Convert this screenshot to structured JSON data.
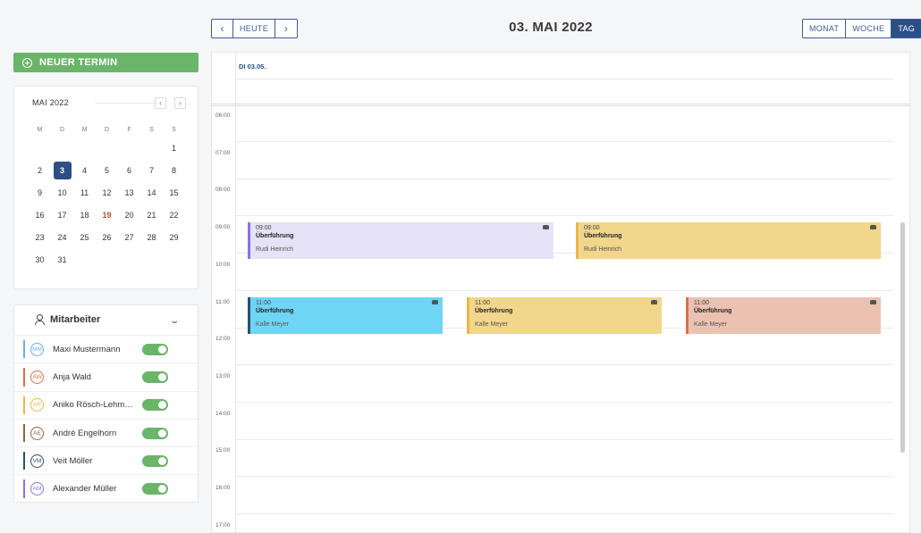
{
  "toolbar": {
    "prev_icon": "chevron-left-icon",
    "today_label": "HEUTE",
    "next_icon": "chevron-right-icon",
    "title": "03. MAI 2022",
    "views": [
      "MONAT",
      "WOCHE",
      "TAG"
    ],
    "active_view": "TAG"
  },
  "sidebar": {
    "new_button_label": "NEUER TERMIN",
    "mini_calendar": {
      "month_label": "MAI 2022",
      "weekdays": [
        "M",
        "D",
        "M",
        "D",
        "F",
        "S",
        "S"
      ],
      "days": [
        "",
        "",
        "",
        "",
        "",
        "",
        "1",
        "2",
        "3",
        "4",
        "5",
        "6",
        "7",
        "8",
        "9",
        "10",
        "11",
        "12",
        "13",
        "14",
        "15",
        "16",
        "17",
        "18",
        "19",
        "20",
        "21",
        "22",
        "23",
        "24",
        "25",
        "26",
        "27",
        "28",
        "29",
        "30",
        "31",
        "",
        "",
        "",
        "",
        ""
      ],
      "selected_day": "3",
      "highlighted_day": "19"
    },
    "staff": {
      "title": "Mitarbeiter",
      "members": [
        {
          "initials": "MM",
          "name": "Maxi Mustermann",
          "color": "#6aaee8",
          "enabled": true
        },
        {
          "initials": "AW",
          "name": "Anja Wald",
          "color": "#d9714a",
          "enabled": true
        },
        {
          "initials": "AR",
          "name": "Aniko Rösch-Lehm…",
          "color": "#e8b84a",
          "enabled": true
        },
        {
          "initials": "AE",
          "name": "André Engelhorn",
          "color": "#8a6a3c",
          "enabled": true
        },
        {
          "initials": "VM",
          "name": "Veit Möller",
          "color": "#2c4f6e",
          "enabled": true
        },
        {
          "initials": "AM",
          "name": "Alexander Müller",
          "color": "#8a72e0",
          "enabled": true
        }
      ]
    }
  },
  "calendar": {
    "day_header": "DI 03.05.",
    "times": [
      "06:00",
      "07:00",
      "08:00",
      "09:00",
      "10:00",
      "11:00",
      "12:00",
      "13:00",
      "14:00",
      "15:00",
      "16:00",
      "17:00"
    ],
    "events": [
      {
        "time": "09:00",
        "subject": "Überführung",
        "person": "Rudi Heinrich",
        "bg": "#e6e3f8",
        "border": "#8a72e0"
      },
      {
        "time": "09:00",
        "subject": "Überführung",
        "person": "Rudi Heinrich",
        "bg": "#f2d68c",
        "border": "#e8b84a"
      },
      {
        "time": "11:00",
        "subject": "Überführung",
        "person": "Kalle Meyer",
        "bg": "#6fd5f5",
        "border": "#2c4f6e"
      },
      {
        "time": "11:00",
        "subject": "Überführung",
        "person": "Kalle Meyer",
        "bg": "#f2d68c",
        "border": "#e8b84a"
      },
      {
        "time": "11:00",
        "subject": "Überführung",
        "person": "Kalle Meyer",
        "bg": "#ebc2b2",
        "border": "#d9714a"
      }
    ]
  }
}
